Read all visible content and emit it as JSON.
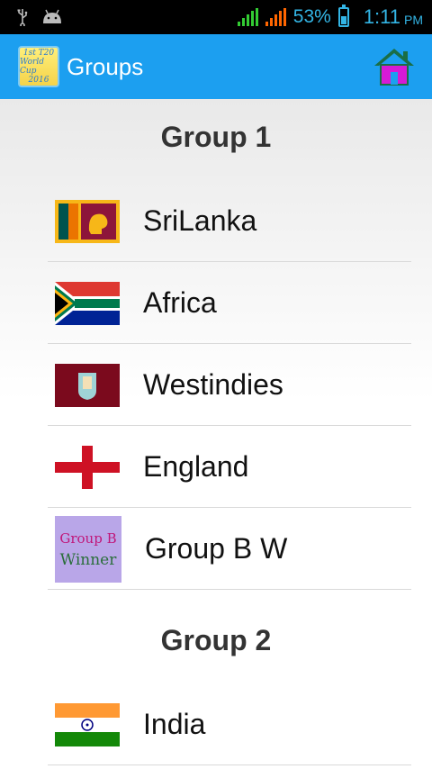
{
  "status_bar": {
    "battery_percent": "53%",
    "time": "1:11",
    "ampm": "PM",
    "icons": [
      "usb-icon",
      "android-icon",
      "signal-icon",
      "signal-icon",
      "battery-charging-icon"
    ]
  },
  "action_bar": {
    "title": "Groups",
    "logo_lines": [
      "1st T20",
      "World Cup",
      "2016"
    ],
    "home_icon": "home-icon"
  },
  "groups": [
    {
      "title": "Group 1",
      "teams": [
        {
          "name": "SriLanka",
          "flag": "srilanka-flag"
        },
        {
          "name": "Africa",
          "flag": "southafrica-flag"
        },
        {
          "name": "Westindies",
          "flag": "westindies-flag"
        },
        {
          "name": "England",
          "flag": "england-flag"
        },
        {
          "name": "Group B W",
          "flag": "group-b-winner-badge",
          "badge_lines": [
            "Group B",
            "Winner"
          ]
        }
      ]
    },
    {
      "title": "Group 2",
      "teams": [
        {
          "name": "India",
          "flag": "india-flag"
        }
      ]
    }
  ],
  "colors": {
    "action_bar": "#1c9ff0",
    "status_accent": "#33b5e5",
    "home_roof": "#1a6e46",
    "home_body": "#d61ad6"
  }
}
